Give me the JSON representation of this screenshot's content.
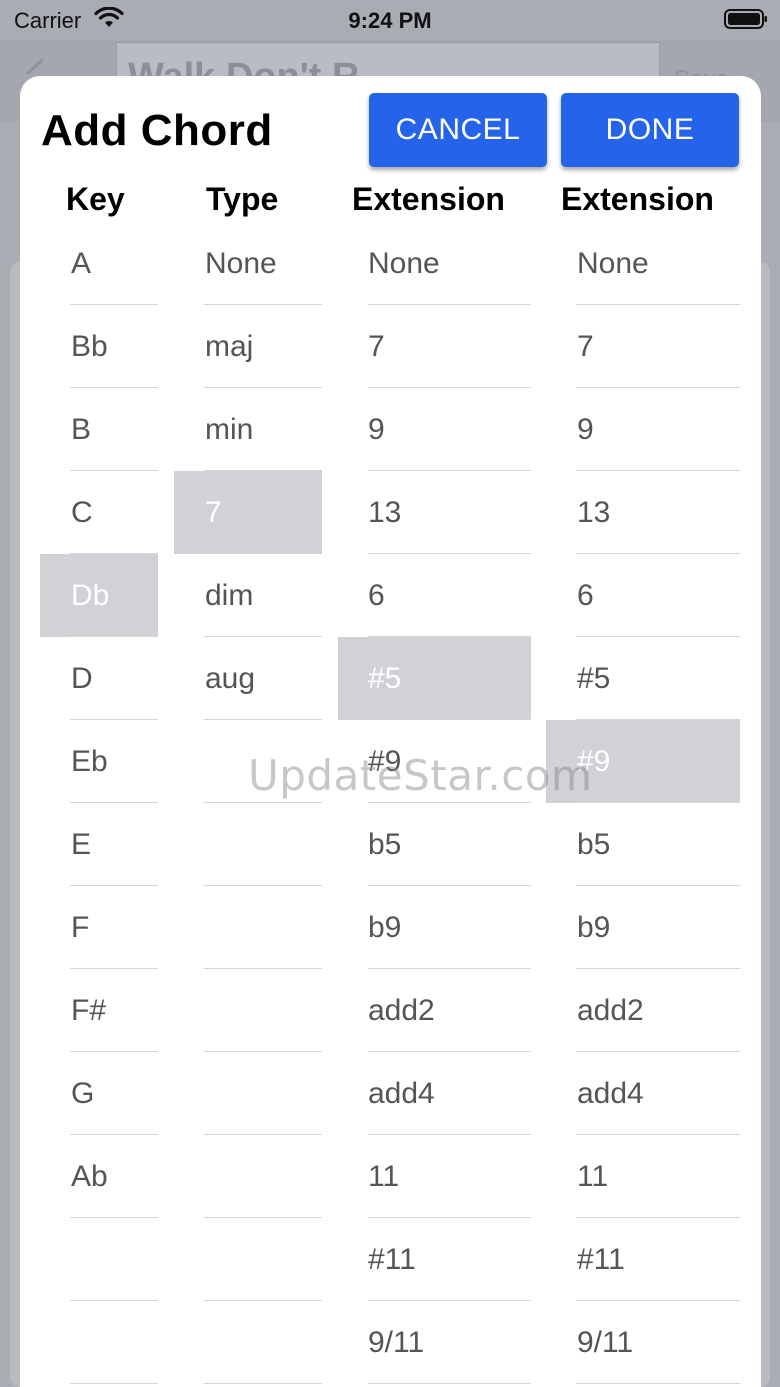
{
  "status_bar": {
    "carrier": "Carrier",
    "time": "9:24 PM"
  },
  "background": {
    "title_text": "Walk Don't R",
    "save_label": "Save"
  },
  "modal": {
    "title": "Add Chord",
    "cancel_label": "CANCEL",
    "done_label": "DONE"
  },
  "headers": {
    "key": "Key",
    "type": "Type",
    "extension1": "Extension",
    "extension2": "Extension"
  },
  "key_items": [
    "A",
    "Bb",
    "B",
    "C",
    "Db",
    "D",
    "Eb",
    "E",
    "F",
    "F#",
    "G",
    "Ab",
    "",
    ""
  ],
  "key_selected": "Db",
  "type_items": [
    "None",
    "maj",
    "min",
    "7",
    "dim",
    "aug",
    "",
    "",
    "",
    "",
    "",
    "",
    "",
    ""
  ],
  "type_selected": "7",
  "ext1_items": [
    "None",
    "7",
    "9",
    "13",
    "6",
    "#5",
    "#9",
    "b5",
    "b9",
    "add2",
    "add4",
    "11",
    "#11",
    "9/11"
  ],
  "ext1_selected": "#5",
  "ext2_items": [
    "None",
    "7",
    "9",
    "13",
    "6",
    "#5",
    "#9",
    "b5",
    "b9",
    "add2",
    "add4",
    "11",
    "#11",
    "9/11"
  ],
  "ext2_selected": "#9",
  "watermark": "UpdateStar.com",
  "colors": {
    "button_blue": "#2563eb",
    "selected_bg": "#d1d1d6"
  }
}
